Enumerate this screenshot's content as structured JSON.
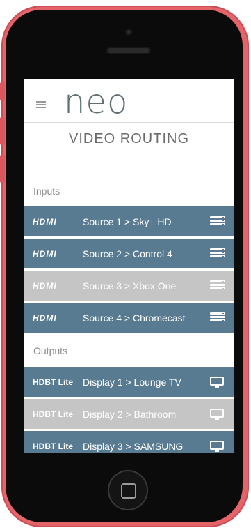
{
  "app": {
    "logo": "neo",
    "title": "VIDEO ROUTING"
  },
  "inputs": {
    "label": "Inputs",
    "rows": [
      {
        "badge": "HDMI",
        "label": "Source 1 > Sky+ HD",
        "state": "active",
        "icon": "input-stack-icon"
      },
      {
        "badge": "HDMI",
        "label": "Source 2 > Control 4",
        "state": "active",
        "icon": "input-stack-icon"
      },
      {
        "badge": "HDMI",
        "label": "Source 3 > Xbox One",
        "state": "inactive",
        "icon": "input-stack-icon"
      },
      {
        "badge": "HDMI",
        "label": "Source 4 > Chromecast",
        "state": "active",
        "icon": "input-stack-icon"
      }
    ]
  },
  "outputs": {
    "label": "Outputs",
    "rows": [
      {
        "badge": "HDBT Lite",
        "label": "Display 1 > Lounge TV",
        "state": "active",
        "icon": "monitor-icon"
      },
      {
        "badge": "HDBT Lite",
        "label": "Display 2 > Bathroom",
        "state": "inactive",
        "icon": "monitor-icon"
      },
      {
        "badge": "HDBT Lite",
        "label": "Display 3 > SAMSUNG",
        "state": "active",
        "icon": "monitor-icon"
      }
    ]
  },
  "colors": {
    "active_row": "#587b92",
    "inactive_row": "#c5c5c5",
    "phone_case": "#e4646a"
  }
}
